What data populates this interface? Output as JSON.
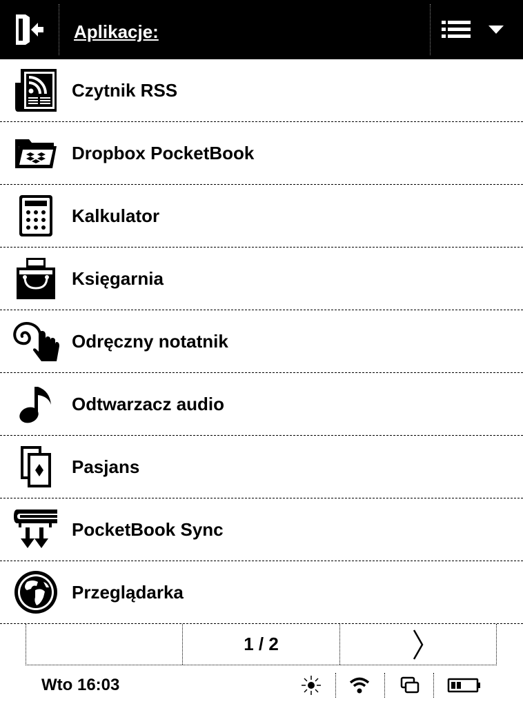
{
  "header": {
    "title": "Aplikacje:",
    "back_icon": "exit-door-icon",
    "menu_icon": "list-menu-icon",
    "dropdown_icon": "chevron-down-icon"
  },
  "apps": [
    {
      "label": "Czytnik RSS",
      "icon": "rss-reader-icon"
    },
    {
      "label": "Dropbox PocketBook",
      "icon": "dropbox-folder-icon"
    },
    {
      "label": "Kalkulator",
      "icon": "calculator-icon"
    },
    {
      "label": "Księgarnia",
      "icon": "bookstore-bag-icon"
    },
    {
      "label": "Odręczny notatnik",
      "icon": "handwriting-notes-icon"
    },
    {
      "label": "Odtwarzacz audio",
      "icon": "music-note-icon"
    },
    {
      "label": "Pasjans",
      "icon": "cards-icon"
    },
    {
      "label": "PocketBook Sync",
      "icon": "sync-books-icon"
    },
    {
      "label": "Przeglądarka",
      "icon": "globe-icon"
    }
  ],
  "pager": {
    "page": "1 / 2",
    "next_icon": "chevron-right-icon"
  },
  "status": {
    "clock": "Wto 16:03",
    "icons": [
      "brightness-icon",
      "wifi-icon",
      "windows-icon",
      "battery-icon"
    ]
  }
}
